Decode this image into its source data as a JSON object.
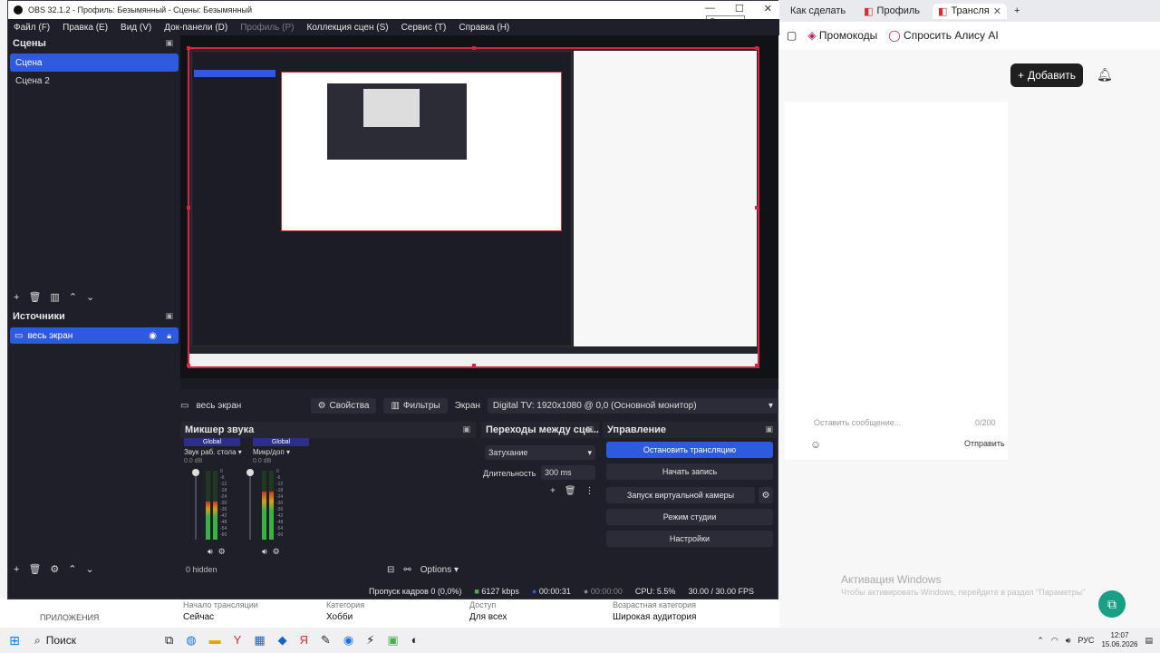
{
  "browser": {
    "tabs": [
      {
        "label": "Как сделать"
      },
      {
        "label": "Профиль"
      },
      {
        "label": "Трансля"
      }
    ],
    "bookmarks": [
      "Промокоды",
      "Спросить Алису AI"
    ],
    "add_button": "Добавить",
    "chat_placeholder": "Оставить сообщение...",
    "chat_count": "0/200",
    "chat_send": "Отправить",
    "activation_title": "Активация Windows",
    "activation_text": "Чтобы активировать Windows, перейдите в раздел \"Параметры\"",
    "stream_info": [
      {
        "label": "Начало трансляции",
        "value": "Сейчас"
      },
      {
        "label": "Категория",
        "value": "Хобби"
      },
      {
        "label": "Доступ",
        "value": "Для всех"
      },
      {
        "label": "Возрастная категория",
        "value": "Широкая аудитория"
      }
    ],
    "apps_label": "ПРИЛОЖЕНИЯ"
  },
  "obs": {
    "title": "OBS 32.1.2 - Профиль: Безымянный - Сцены: Безымянный",
    "tooltip": "Свернуть",
    "menu": [
      {
        "label": "Файл (F)",
        "disabled": false
      },
      {
        "label": "Правка (E)",
        "disabled": false
      },
      {
        "label": "Вид (V)",
        "disabled": false
      },
      {
        "label": "Док-панели (D)",
        "disabled": false
      },
      {
        "label": "Профиль (P)",
        "disabled": true
      },
      {
        "label": "Коллекция сцен (S)",
        "disabled": false
      },
      {
        "label": "Сервис (T)",
        "disabled": false
      },
      {
        "label": "Справка (H)",
        "disabled": false
      }
    ],
    "scenes_title": "Сцены",
    "scenes": [
      "Сцена",
      "Сцена 2"
    ],
    "selected_scene": 0,
    "sources_title": "Источники",
    "sources": [
      "весь экран"
    ],
    "context": {
      "source_name": "весь экран",
      "properties": "Свойства",
      "filters": "Фильтры",
      "screen_label": "Экран",
      "screen_value": "Digital TV: 1920x1080 @ 0,0 (Основной монитор)"
    },
    "mixer": {
      "title": "Микшер звука",
      "channels": [
        {
          "tag": "Global",
          "name": "Звук раб. стола",
          "db": "0.0 dB",
          "level": 0.55
        },
        {
          "tag": "Global",
          "name": "Микр/доп",
          "db": "0.0 dB",
          "level": 0.7
        }
      ],
      "scale": [
        "0",
        "-6",
        "-12",
        "-18",
        "-24",
        "-30",
        "-36",
        "-42",
        "-48",
        "-54",
        "-60"
      ],
      "hidden": "0 hidden",
      "options": "Options"
    },
    "transitions": {
      "title": "Переходы между сце...",
      "selected": "Затухание",
      "duration_label": "Длительность",
      "duration": "300 ms"
    },
    "controls": {
      "title": "Управление",
      "stop_stream": "Остановить трансляцию",
      "start_record": "Начать запись",
      "virtual_cam": "Запуск виртуальной камеры",
      "studio_mode": "Режим студии",
      "settings": "Настройки"
    },
    "status": {
      "dropped": "Пропуск кадров 0 (0,0%)",
      "bitrate": "6127 kbps",
      "stream_time": "00:00:31",
      "rec_time": "00:00:00",
      "cpu": "CPU: 5.5%",
      "fps": "30.00 / 30.00 FPS"
    }
  },
  "taskbar": {
    "search": "Поиск",
    "lang": "РУС",
    "time": "12:07",
    "date": "15.06.2026"
  },
  "colors": {
    "obs_bg": "#1e1f29",
    "accent": "#2d5ade",
    "preview_border": "#d7263d"
  }
}
